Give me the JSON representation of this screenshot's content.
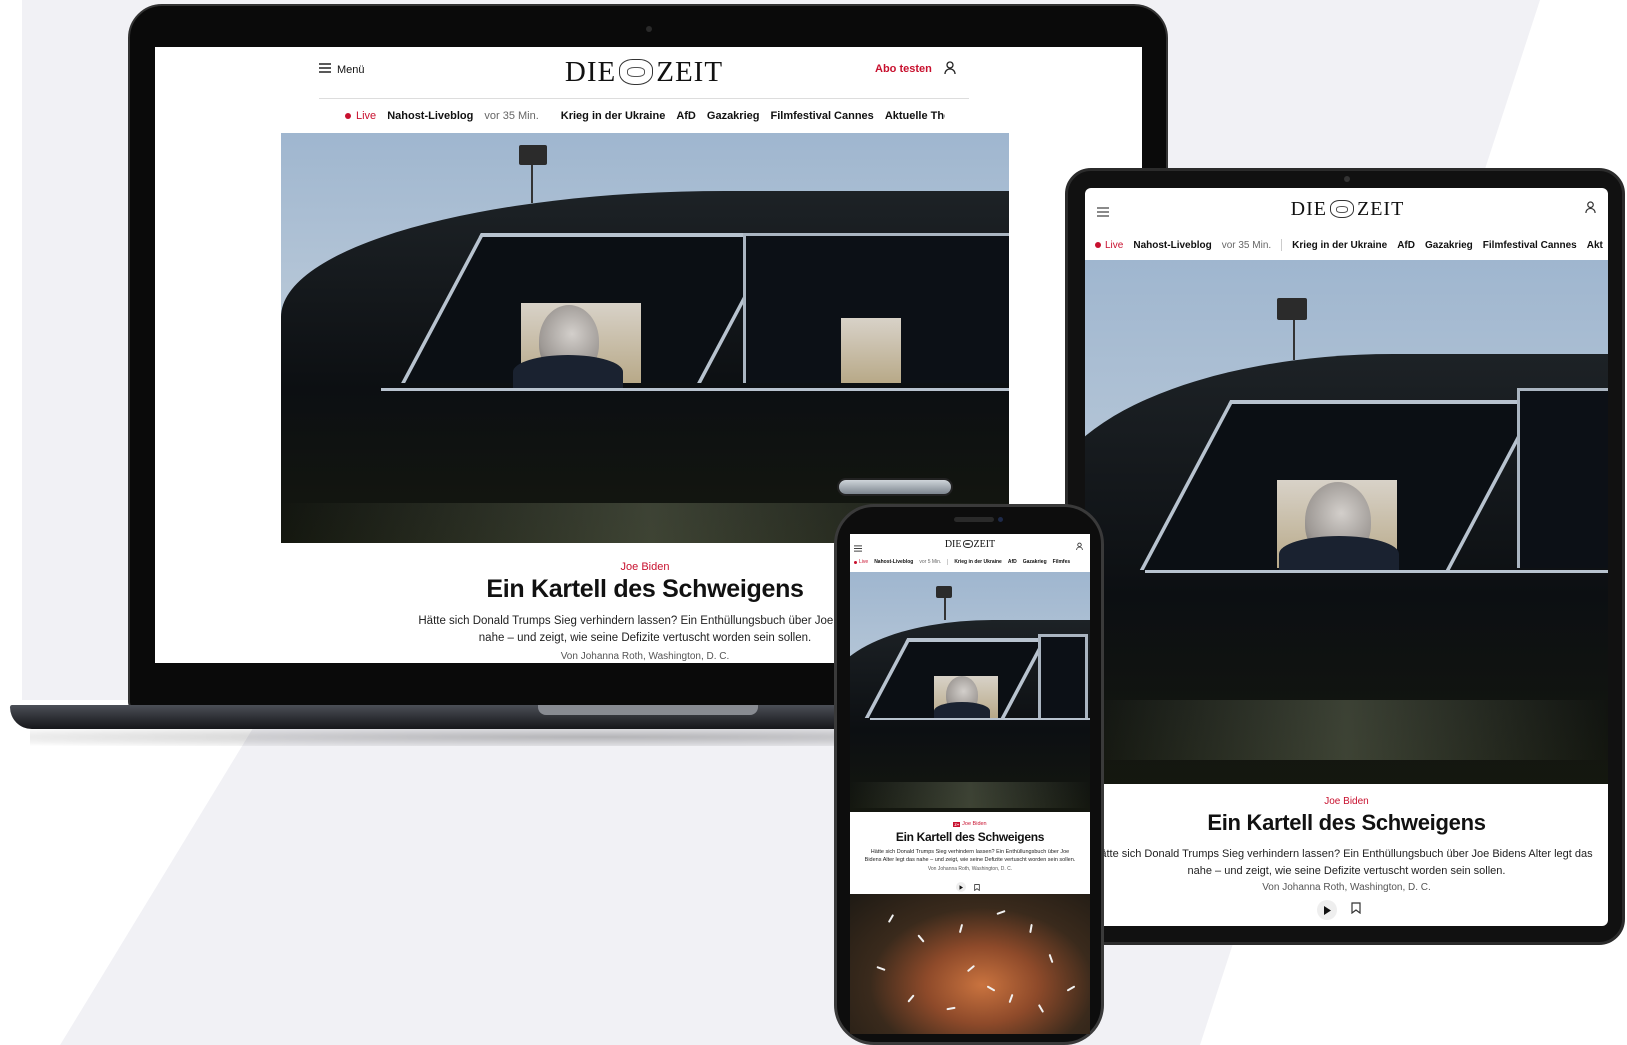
{
  "site": {
    "logo_text_left": "DIE",
    "logo_text_right": "ZEIT",
    "menu_label": "Menü",
    "abo_label": "Abo testen",
    "accent_color": "#c8102e"
  },
  "nav": {
    "live_label": "Live",
    "liveblog_label": "Nahost-Liveblog",
    "liveblog_time": "vor 35 Min.",
    "phone_liveblog_time": "vor 5 Min.",
    "items": [
      "Krieg in der Ukraine",
      "AfD",
      "Gazakrieg",
      "Filmfestival Cannes",
      "Aktuelle Themen"
    ],
    "tablet_cut_item": "Akt",
    "phone_cut_item": "Filmfes"
  },
  "article": {
    "kicker": "Joe Biden",
    "headline": "Ein Kartell des Schweigens",
    "teaser_line1": "Hätte sich Donald Trumps Sieg verhindern lassen? Ein Enthüllungsbuch über Joe Bidens",
    "teaser_line2": "nahe – und zeigt, wie seine Defizite vertuscht worden sein sollen.",
    "tablet_teaser_line1": "ätte sich Donald Trumps Sieg verhindern lassen? Ein Enthüllungsbuch über Joe Bidens Alter legt das",
    "tablet_teaser_line2": "nahe – und zeigt, wie seine Defizite vertuscht worden sein sollen.",
    "phone_teaser_line1": "Hätte sich Donald Trumps Sieg verhindern lassen? Ein Enthüllungsbuch über Joe",
    "phone_teaser_line2": "Bidens Alter legt das nahe – und zeigt, wie seine Defizite vertuscht worden sein sollen.",
    "byline": "Von Johanna Roth, Washington, D. C.",
    "phone_zplus_badge": "Z+"
  }
}
